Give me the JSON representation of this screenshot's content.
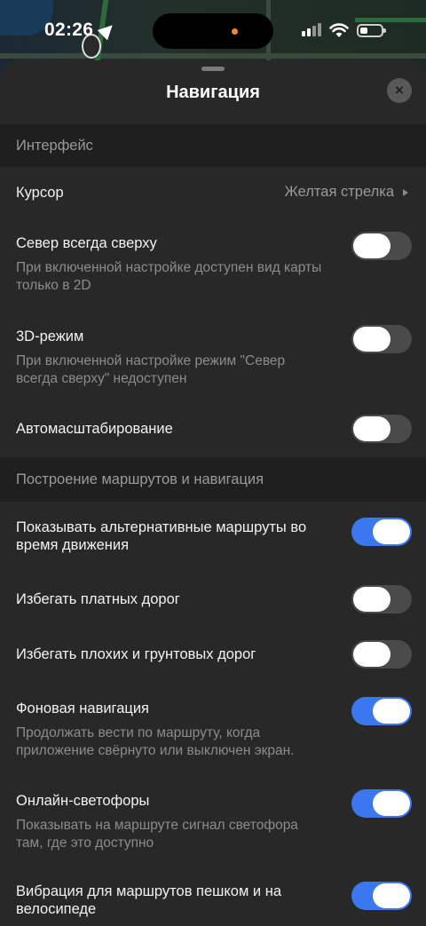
{
  "status_bar": {
    "time": "02:26"
  },
  "sheet": {
    "title": "Навигация",
    "close_symbol": "×"
  },
  "sections": {
    "interface": "Интерфейс",
    "routing": "Построение маршрутов и навигация"
  },
  "rows": {
    "cursor": {
      "label": "Курсор",
      "value": "Желтая стрелка"
    },
    "north_up": {
      "label": "Север всегда сверху",
      "description": "При включенной настройке доступен вид карты только в 2D",
      "enabled": false
    },
    "mode_3d": {
      "label": "3D-режим",
      "description": "При включенной настройке режим \"Север всегда сверху\" недоступен",
      "enabled": false
    },
    "autoscale": {
      "label": "Автомасштабирование",
      "enabled": false
    },
    "alt_routes": {
      "label": "Показывать альтернативные маршруты во время движения",
      "enabled": true
    },
    "avoid_tolls": {
      "label": "Избегать платных дорог",
      "enabled": false
    },
    "avoid_bad_roads": {
      "label": "Избегать плохих и грунтовых дорог",
      "enabled": false
    },
    "background_nav": {
      "label": "Фоновая навигация",
      "description": "Продолжать вести по маршруту, когда приложение свёрнуто или выключен экран.",
      "enabled": true
    },
    "traffic_lights": {
      "label": "Онлайн-светофоры",
      "description": "Показывать на маршруте сигнал светофора там, где это доступно",
      "enabled": true
    },
    "vibration": {
      "label": "Вибрация для маршрутов пешком и на велосипеде",
      "enabled": true
    }
  },
  "colors": {
    "accent": "#3b78f0",
    "sheet_bg": "#282828",
    "section_bg": "#1f1f1f"
  },
  "icons": [
    "location-arrow-icon",
    "signal-icon",
    "wifi-icon",
    "battery-icon",
    "close-icon",
    "chevron-right-icon",
    "map-pin-icon"
  ]
}
